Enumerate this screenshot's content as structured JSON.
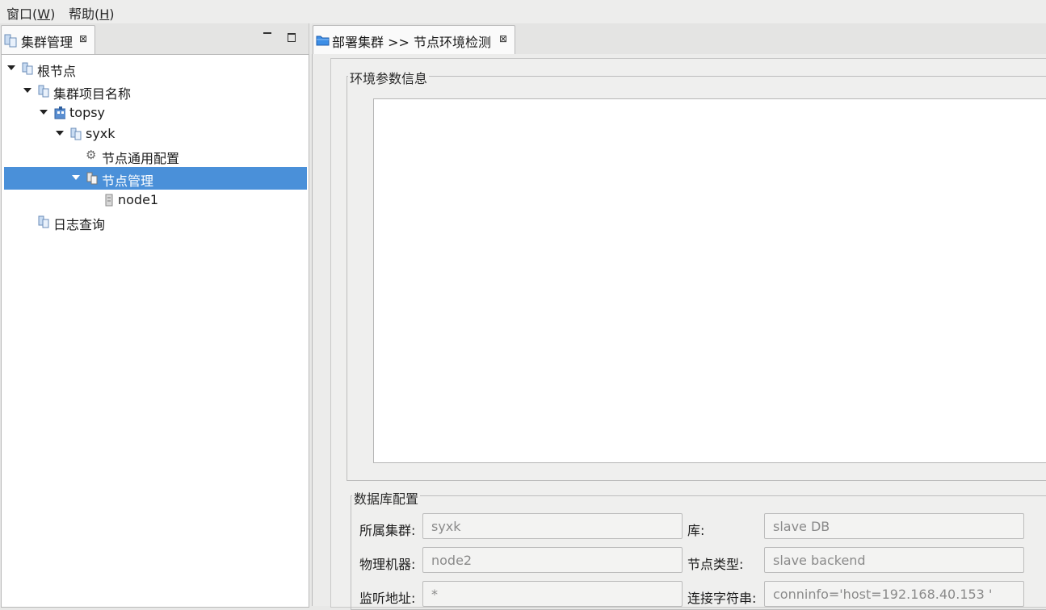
{
  "menubar": {
    "items": [
      {
        "label": "窗口(",
        "mnemonic": "W",
        "suffix": ")"
      },
      {
        "label": "帮助(",
        "mnemonic": "H",
        "suffix": ")"
      }
    ]
  },
  "left_view": {
    "tab_label": "集群管理",
    "tree": [
      {
        "label": "根节点",
        "icon": "cluster-icon"
      },
      {
        "label": "集群项目名称",
        "icon": "cluster-icon"
      },
      {
        "label": "topsy",
        "icon": "building-icon"
      },
      {
        "label": "syxk",
        "icon": "cluster-icon"
      },
      {
        "label": "节点通用配置",
        "icon": "gear-icon"
      },
      {
        "label": "节点管理",
        "icon": "node-group-icon"
      },
      {
        "label": "node1",
        "icon": "server-icon"
      },
      {
        "label": "日志查询",
        "icon": "cluster-icon"
      }
    ]
  },
  "editor": {
    "tab_label": "部署集群 >> 节点环境检测",
    "env_group_title": "环境参数信息",
    "db_group_title": "数据库配置",
    "fields": {
      "cluster": {
        "label": "所属集群:",
        "value": "syxk"
      },
      "database": {
        "label": "库:",
        "value": "slave DB"
      },
      "machine": {
        "label": "物理机器:",
        "value": "node2"
      },
      "node_type": {
        "label": "节点类型:",
        "value": "slave backend"
      },
      "listen": {
        "label": "监听地址:",
        "value": "*"
      },
      "conninfo": {
        "label": "连接字符串:",
        "value": "conninfo='host=192.168.40.153 '"
      }
    }
  },
  "colors": {
    "selection": "#4a90d9",
    "folder": "#3c8ee6"
  }
}
